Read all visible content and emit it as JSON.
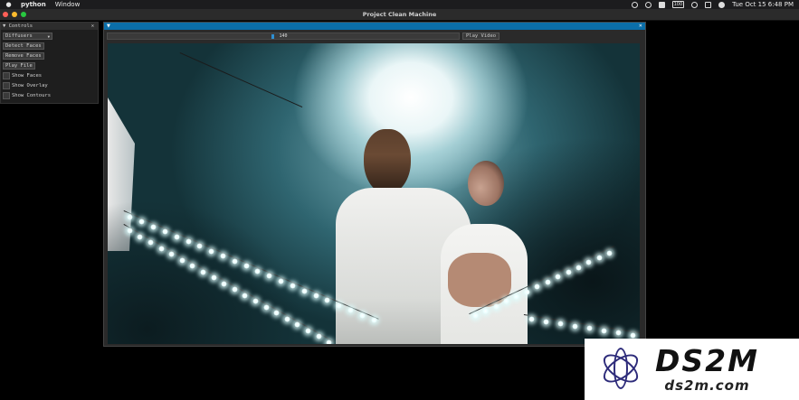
{
  "menubar": {
    "app_name": "python",
    "menu_window": "Window",
    "battery_badge": "100",
    "clock": "Tue Oct 15  6:48 PM"
  },
  "window": {
    "title": "Project Clean Machine"
  },
  "controls": {
    "header": "▼ Controls",
    "close": "✕",
    "model_select": "Diffusers",
    "buttons": {
      "detect": "Detect Faces",
      "remove": "Remove Faces",
      "play": "Play File"
    },
    "checkboxes": [
      {
        "label": "Show Faces",
        "checked": false
      },
      {
        "label": "Show Overlay",
        "checked": false
      },
      {
        "label": "Show Contours",
        "checked": false
      }
    ]
  },
  "player": {
    "header_arrow": "▼",
    "close": "✕",
    "frame_value": "140",
    "frame_progress": 0.47,
    "play_button": "Play Video"
  },
  "watermark": {
    "brand": "DS2M",
    "url": "ds2m.com"
  },
  "colors": {
    "accent": "#0b6ea8",
    "slider_knob": "#2e8fd2",
    "close": "#ff5f57",
    "minimize": "#febc2e",
    "maximize": "#28c840"
  }
}
